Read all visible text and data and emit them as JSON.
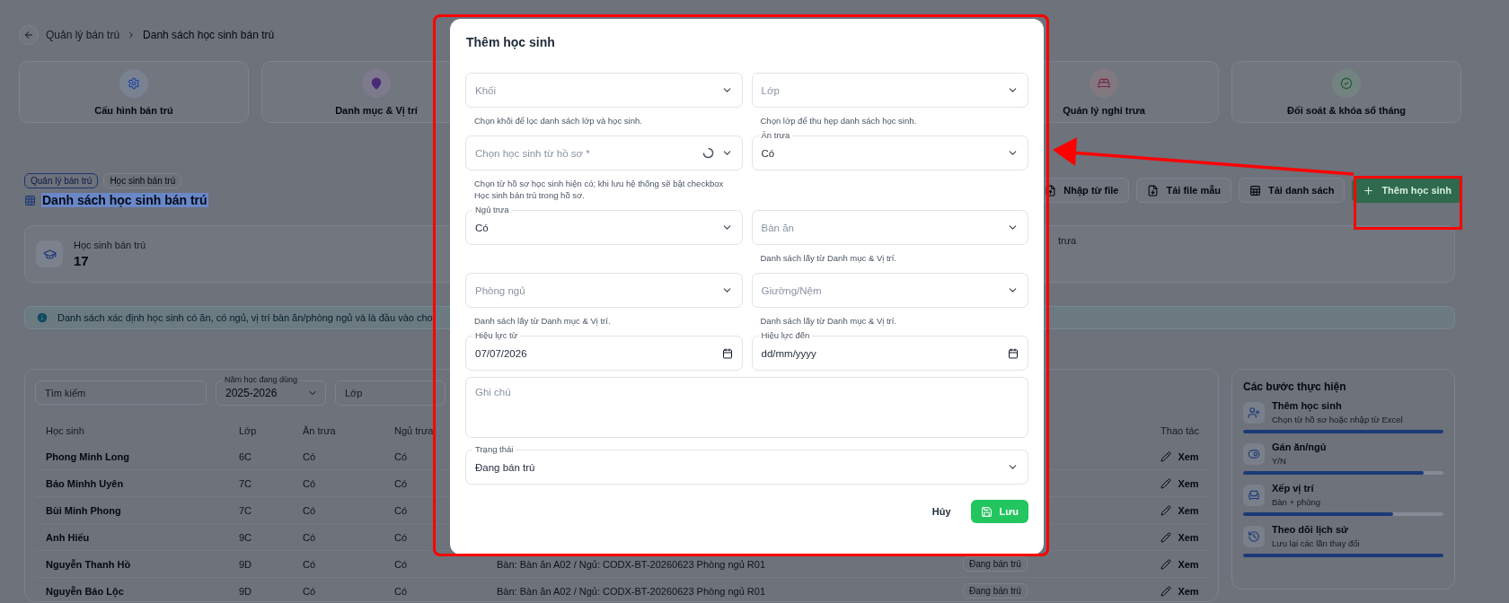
{
  "breadcrumb": [
    "Quản lý bán trú",
    "Danh sách học sinh bán trú"
  ],
  "nav_cards": [
    {
      "kind": "settings",
      "label": "Cấu hình bán trú"
    },
    {
      "kind": "location",
      "label": "Danh mục & Vị trí"
    },
    {
      "kind": "bed",
      "label": "Quản lý nghỉ trưa"
    },
    {
      "kind": "verified",
      "label": "Đối soát & khóa sổ tháng"
    }
  ],
  "tags": [
    {
      "label": "Quản lý bán trú",
      "selected": true
    },
    {
      "label": "Học sinh bán trú",
      "selected": false
    }
  ],
  "page_title": "Danh sách học sinh bán trú",
  "toolbar": [
    {
      "kind": "upload",
      "label": "Nhập từ file"
    },
    {
      "kind": "download",
      "label": "Tải file mẫu"
    },
    {
      "kind": "export",
      "label": "Tải danh sách"
    },
    {
      "kind": "primary",
      "label": "Thêm học sinh"
    }
  ],
  "stats": [
    {
      "kind": "students",
      "label": "Học sinh bán trú",
      "value": "17"
    },
    {
      "kind": "partial",
      "label": "trưa"
    }
  ],
  "info_banner": "Danh sách xác định học sinh có ăn, có ngủ, vị trí bàn ăn/phòng ngủ và là đầu vào cho",
  "filters": {
    "search_placeholder": "Tìm kiếm",
    "school_year": {
      "label": "Năm học đang dùng",
      "value": "2025-2026"
    },
    "class_placeholder": "Lớp"
  },
  "table": {
    "columns": [
      "Học sinh",
      "Lớp",
      "Ăn trưa",
      "Ngủ trưa",
      "Thao tác"
    ],
    "rows": [
      {
        "student": "Phong Minh Long",
        "class": "6C",
        "lunch": "Có",
        "nap": "Có",
        "action": "Xem"
      },
      {
        "student": "Bảo Minhh Uyên",
        "class": "7C",
        "lunch": "Có",
        "nap": "Có",
        "action": "Xem"
      },
      {
        "student": "Bùi Minh Phong",
        "class": "7C",
        "lunch": "Có",
        "nap": "Có",
        "action": "Xem"
      },
      {
        "student": "Anh Hiếu",
        "class": "9C",
        "lunch": "Có",
        "nap": "Có",
        "action": "Xem"
      },
      {
        "student": "Nguyễn Thanh Hồ",
        "class": "9D",
        "lunch": "Có",
        "nap": "Có",
        "position": "Bàn: Bàn ăn A02 / Ngủ: CODX-BT-20260623 Phòng ngủ R01",
        "status": "Đang bán trú",
        "action": "Xem"
      },
      {
        "student": "Nguyễn Bảo Lộc",
        "class": "9D",
        "lunch": "Có",
        "nap": "Có",
        "position": "Bàn: Bàn ăn A02 / Ngủ: CODX-BT-20260623 Phòng ngủ R01",
        "status": "Đang bán trú",
        "action": "Xem"
      }
    ]
  },
  "steps": {
    "title": "Các bước thực hiện",
    "items": [
      {
        "kind": "add-user",
        "title": "Thêm học sinh",
        "subtitle": "Chọn từ hồ sơ hoặc nhập từ Excel",
        "level": 1
      },
      {
        "kind": "toggle",
        "title": "Gán ăn/ngủ",
        "subtitle": "Y/N",
        "level": 0.9
      },
      {
        "kind": "seat",
        "title": "Xếp vị trí",
        "subtitle": "Bàn + phòng",
        "level": 0.75
      },
      {
        "kind": "history",
        "title": "Theo dõi lịch sử",
        "subtitle": "Lưu lại các lần thay đổi",
        "level": 1
      }
    ]
  },
  "modal": {
    "title": "Thêm học sinh",
    "field_rows": [
      {
        "fields": [
          {
            "kind": "select",
            "placeholder": "Khối",
            "helper": "Chọn khối để lọc danh sách lớp và học sinh."
          },
          {
            "kind": "select",
            "placeholder": "Lớp",
            "helper": "Chọn lớp để thu hẹp danh sách học sinh."
          }
        ]
      },
      {
        "fields": [
          {
            "kind": "select",
            "placeholder": "Chọn học sinh từ hồ sơ *",
            "loading": true,
            "helper": "Chọn từ hồ sơ học sinh hiện có; khi lưu hệ thống sẽ bật checkbox Học sinh bán trú trong hồ sơ."
          },
          {
            "kind": "select",
            "label": "Ăn trưa",
            "value": "Có"
          }
        ]
      },
      {
        "fields": [
          {
            "kind": "select",
            "label": "Ngủ trưa",
            "value": "Có"
          },
          {
            "kind": "select",
            "placeholder": "Bàn ăn",
            "helper": "Danh sách lấy từ Danh mục & Vị trí."
          }
        ]
      },
      {
        "fields": [
          {
            "kind": "select",
            "placeholder": "Phòng ngủ",
            "helper": "Danh sách lấy từ Danh mục & Vị trí."
          },
          {
            "kind": "select",
            "placeholder": "Giường/Nệm",
            "helper": "Danh sách lấy từ Danh mục & Vị trí."
          }
        ]
      },
      {
        "fields": [
          {
            "kind": "date",
            "label": "Hiệu lực từ",
            "value": "07/07/2026"
          },
          {
            "kind": "date",
            "label": "Hiệu lực đến",
            "placeholder": "dd/mm/yyyy"
          }
        ]
      }
    ],
    "note": {
      "placeholder": "Ghi chú"
    },
    "status": {
      "label": "Trạng thái",
      "value": "Đang bán trú"
    },
    "cancel": "Hủy",
    "save": "Lưu"
  }
}
